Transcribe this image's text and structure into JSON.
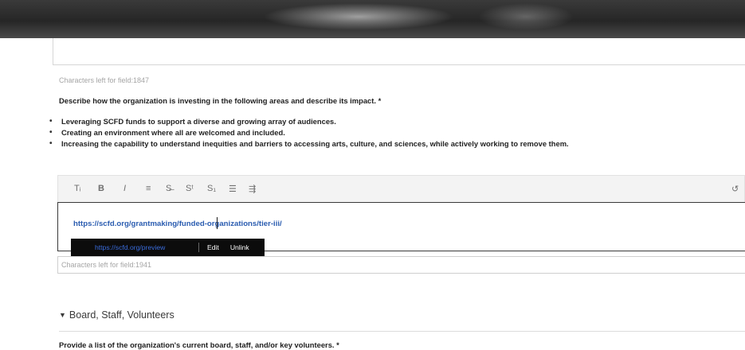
{
  "chars_left_prev": "Characters left for field:1847",
  "question": "Describe how the organization is investing in the following areas and describe its impact. *",
  "bullets": [
    "Leveraging SCFD funds to support a diverse and growing array of audiences.",
    "Creating an environment where all are welcomed and included.",
    "Increasing the capability to understand inequities and barriers to accessing arts, culture, and sciences, while actively working to remove them."
  ],
  "toolbar": {
    "items": [
      {
        "icon": "text-style-icon",
        "glyph": "Tᵢ"
      },
      {
        "icon": "bold-icon",
        "glyph": "B"
      },
      {
        "icon": "italic-icon",
        "glyph": "I"
      },
      {
        "icon": "align-icon",
        "glyph": "≡"
      },
      {
        "icon": "strikethrough-icon",
        "glyph": "S̶"
      },
      {
        "icon": "superscript-icon",
        "glyph": "Sᵗ"
      },
      {
        "icon": "subscript-icon",
        "glyph": "S₁"
      },
      {
        "icon": "bullet-list-icon",
        "glyph": "☰"
      },
      {
        "icon": "indent-icon",
        "glyph": "⇶"
      }
    ],
    "undo": {
      "icon": "undo-icon",
      "glyph": "↺"
    }
  },
  "editor": {
    "link": "https://scfd.org/grantmaking/funded-organizations/tier-iii/"
  },
  "link_popup": {
    "url": "https://scfd.org/preview",
    "edit": "Edit",
    "unlink": "Unlink"
  },
  "chars_left": "Characters left for field:1941",
  "section": {
    "title": "Board, Staff, Volunteers",
    "icon": "caret-down-icon"
  },
  "question2": "Provide a list of the organization's current board, staff, and/or key volunteers. *",
  "colors": {
    "link": "#2a5cb0",
    "popup_bg": "#0c0c0c",
    "popup_url": "#3a6cdc"
  }
}
